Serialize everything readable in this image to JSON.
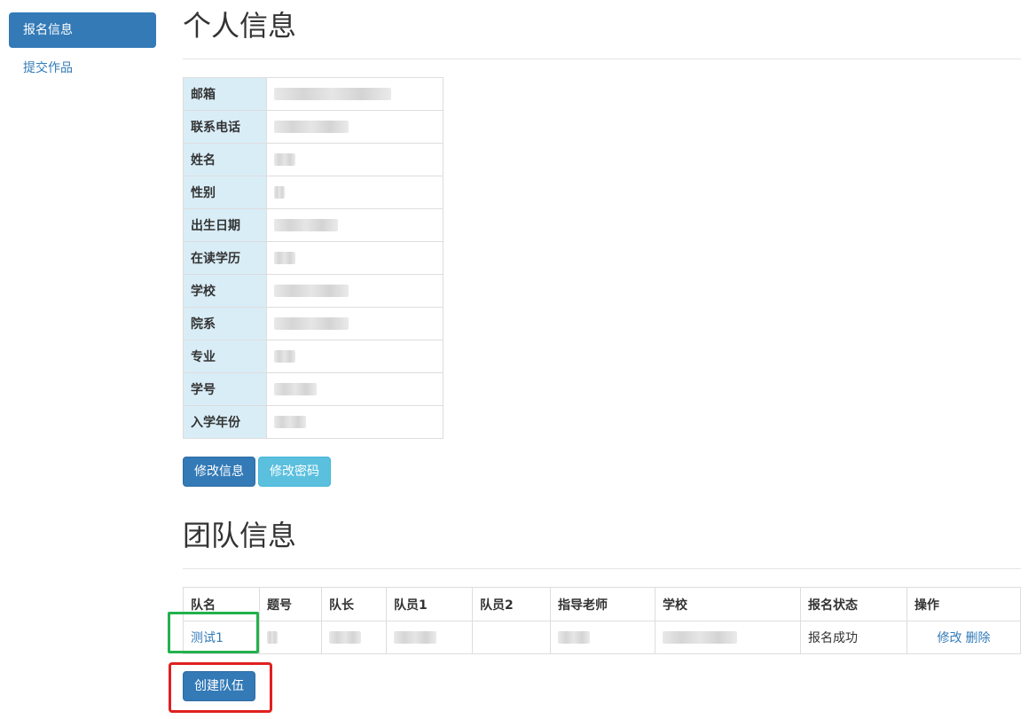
{
  "sidebar": {
    "items": [
      {
        "label": "报名信息",
        "active": true
      },
      {
        "label": "提交作品",
        "active": false
      }
    ]
  },
  "personal": {
    "title": "个人信息",
    "fields": [
      {
        "label": "邮箱"
      },
      {
        "label": "联系电话"
      },
      {
        "label": "姓名"
      },
      {
        "label": "性别"
      },
      {
        "label": "出生日期"
      },
      {
        "label": "在读学历"
      },
      {
        "label": "学校"
      },
      {
        "label": "院系"
      },
      {
        "label": "专业"
      },
      {
        "label": "学号"
      },
      {
        "label": "入学年份"
      }
    ],
    "edit_button": "修改信息",
    "password_button": "修改密码"
  },
  "team": {
    "title": "团队信息",
    "headers": [
      "队名",
      "题号",
      "队长",
      "队员1",
      "队员2",
      "指导老师",
      "学校",
      "报名状态",
      "操作"
    ],
    "rows": [
      {
        "name": "测试1",
        "status": "报名成功",
        "edit": "修改",
        "delete": "删除"
      }
    ],
    "create_button": "创建队伍"
  },
  "colors": {
    "primary": "#337ab7",
    "info": "#5bc0de",
    "danger": "#d9534f",
    "label_bg": "#d9edf7",
    "highlight_green": "#22b14c",
    "highlight_red": "#e02020"
  }
}
